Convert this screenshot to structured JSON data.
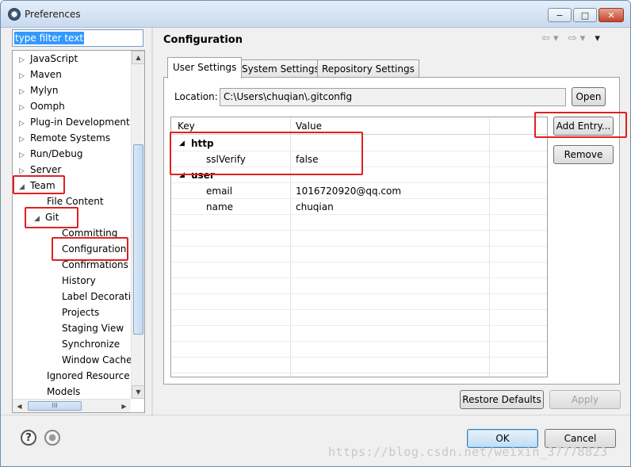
{
  "window": {
    "title": "Preferences",
    "controls": {
      "minimize": "−",
      "maximize": "□",
      "close": "✕"
    }
  },
  "sidebar": {
    "filter_placeholder": "type filter text",
    "items": [
      {
        "label": "JavaScript",
        "arrow": "▷"
      },
      {
        "label": "Maven",
        "arrow": "▷"
      },
      {
        "label": "Mylyn",
        "arrow": "▷"
      },
      {
        "label": "Oomph",
        "arrow": "▷"
      },
      {
        "label": "Plug-in Development",
        "arrow": "▷"
      },
      {
        "label": "Remote Systems",
        "arrow": "▷"
      },
      {
        "label": "Run/Debug",
        "arrow": "▷"
      },
      {
        "label": "Server",
        "arrow": "▷"
      },
      {
        "label": "Team",
        "arrow": "◢"
      },
      {
        "label": "File Content",
        "arrow": ""
      },
      {
        "label": "Git",
        "arrow": "◢"
      },
      {
        "label": "Committing",
        "arrow": ""
      },
      {
        "label": "Configuration",
        "arrow": ""
      },
      {
        "label": "Confirmations a",
        "arrow": ""
      },
      {
        "label": "History",
        "arrow": ""
      },
      {
        "label": "Label Decoratio",
        "arrow": ""
      },
      {
        "label": "Projects",
        "arrow": ""
      },
      {
        "label": "Staging View",
        "arrow": ""
      },
      {
        "label": "Synchronize",
        "arrow": ""
      },
      {
        "label": "Window Cache",
        "arrow": ""
      },
      {
        "label": "Ignored Resource",
        "arrow": ""
      },
      {
        "label": "Models",
        "arrow": ""
      }
    ],
    "hscroll_grip": "III"
  },
  "main": {
    "title": "Configuration",
    "nav": {
      "back": "⇦ ▾",
      "forward": "⇨ ▾",
      "menu": "▾"
    },
    "tabs": [
      {
        "label": "User Settings"
      },
      {
        "label": "System Settings"
      },
      {
        "label": "Repository Settings"
      }
    ],
    "location": {
      "label": "Location:",
      "value": "C:\\Users\\chuqian\\.gitconfig",
      "open_button": "Open"
    },
    "table": {
      "headers": {
        "key": "Key",
        "value": "Value"
      },
      "rows": [
        {
          "key": "http",
          "value": "",
          "section": true,
          "expander": "◢"
        },
        {
          "key": "sslVerify",
          "value": "false",
          "section": false,
          "expander": ""
        },
        {
          "key": "user",
          "value": "",
          "section": true,
          "expander": "◢"
        },
        {
          "key": "email",
          "value": "1016720920@qq.com",
          "section": false,
          "expander": ""
        },
        {
          "key": "name",
          "value": "chuqian",
          "section": false,
          "expander": ""
        }
      ]
    },
    "buttons": {
      "add_entry": "Add Entry...",
      "remove": "Remove"
    },
    "restore_defaults": "Restore Defaults",
    "apply": "Apply"
  },
  "footer": {
    "help_icon": "?",
    "ok": "OK",
    "cancel": "Cancel",
    "watermark": "https://blog.csdn.net/weixin_37778823"
  },
  "colors": {
    "annotation": "#e02020",
    "selection": "#3399ff"
  }
}
